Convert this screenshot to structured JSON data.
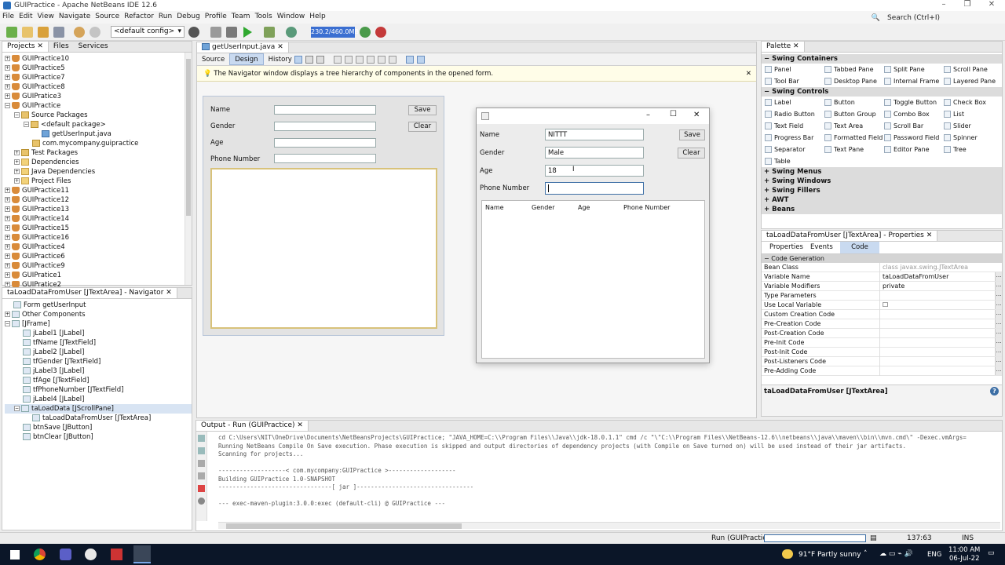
{
  "window": {
    "title": "GUIPractice - Apache NetBeans IDE 12.6"
  },
  "menu": [
    "File",
    "Edit",
    "View",
    "Navigate",
    "Source",
    "Refactor",
    "Run",
    "Debug",
    "Profile",
    "Team",
    "Tools",
    "Window",
    "Help"
  ],
  "search": {
    "placeholder": "Search (Ctrl+I)"
  },
  "toolbar": {
    "config": "<default config>",
    "memory": "230.2/460.0MB"
  },
  "projects": {
    "tabs": [
      "Projects",
      "Files",
      "Services"
    ],
    "items": [
      {
        "label": "GUIPractice10",
        "type": "cup",
        "indent": 0,
        "exp": "+"
      },
      {
        "label": "GUIPractice5",
        "type": "cup",
        "indent": 0,
        "exp": "+"
      },
      {
        "label": "GUIPractice7",
        "type": "cup",
        "indent": 0,
        "exp": "+"
      },
      {
        "label": "GUIPractice8",
        "type": "cup",
        "indent": 0,
        "exp": "+"
      },
      {
        "label": "GUIPratice3",
        "type": "cup",
        "indent": 0,
        "exp": "+"
      },
      {
        "label": "GUIPractice",
        "type": "cup",
        "indent": 0,
        "exp": "-"
      },
      {
        "label": "Source Packages",
        "type": "pkg",
        "indent": 1,
        "exp": "-"
      },
      {
        "label": "<default package>",
        "type": "pkg",
        "indent": 2,
        "exp": "-"
      },
      {
        "label": "getUserInput.java",
        "type": "jv",
        "indent": 3,
        "exp": ""
      },
      {
        "label": "com.mycompany.guipractice",
        "type": "pkg",
        "indent": 2,
        "exp": ""
      },
      {
        "label": "Test Packages",
        "type": "pkg",
        "indent": 1,
        "exp": "+"
      },
      {
        "label": "Dependencies",
        "type": "fld",
        "indent": 1,
        "exp": "+"
      },
      {
        "label": "Java Dependencies",
        "type": "fld",
        "indent": 1,
        "exp": "+"
      },
      {
        "label": "Project Files",
        "type": "fld",
        "indent": 1,
        "exp": "+"
      },
      {
        "label": "GUIPractice11",
        "type": "cup",
        "indent": 0,
        "exp": "+"
      },
      {
        "label": "GUIPractice12",
        "type": "cup",
        "indent": 0,
        "exp": "+"
      },
      {
        "label": "GUIPractice13",
        "type": "cup",
        "indent": 0,
        "exp": "+"
      },
      {
        "label": "GUIPractice14",
        "type": "cup",
        "indent": 0,
        "exp": "+"
      },
      {
        "label": "GUIPractice15",
        "type": "cup",
        "indent": 0,
        "exp": "+"
      },
      {
        "label": "GUIPractice16",
        "type": "cup",
        "indent": 0,
        "exp": "+"
      },
      {
        "label": "GUIPractice4",
        "type": "cup",
        "indent": 0,
        "exp": "+"
      },
      {
        "label": "GUIPractice6",
        "type": "cup",
        "indent": 0,
        "exp": "+"
      },
      {
        "label": "GUIPractice9",
        "type": "cup",
        "indent": 0,
        "exp": "+"
      },
      {
        "label": "GUIPratice1",
        "type": "cup",
        "indent": 0,
        "exp": "+"
      },
      {
        "label": "GUIPratice2",
        "type": "cup",
        "indent": 0,
        "exp": "+"
      }
    ]
  },
  "navigator": {
    "title": "taLoadDataFromUser [JTextArea] - Navigator",
    "items": [
      {
        "label": "Form getUserInput",
        "indent": 0,
        "exp": ""
      },
      {
        "label": "Other Components",
        "indent": 0,
        "exp": "+"
      },
      {
        "label": "[JFrame]",
        "indent": 0,
        "exp": "-"
      },
      {
        "label": "jLabel1 [JLabel]",
        "indent": 1,
        "exp": ""
      },
      {
        "label": "tfName [JTextField]",
        "indent": 1,
        "exp": ""
      },
      {
        "label": "jLabel2 [JLabel]",
        "indent": 1,
        "exp": ""
      },
      {
        "label": "tfGender [JTextField]",
        "indent": 1,
        "exp": ""
      },
      {
        "label": "jLabel3 [JLabel]",
        "indent": 1,
        "exp": ""
      },
      {
        "label": "tfAge [JTextField]",
        "indent": 1,
        "exp": ""
      },
      {
        "label": "tfPhoneNumber [JTextField]",
        "indent": 1,
        "exp": ""
      },
      {
        "label": "jLabel4 [JLabel]",
        "indent": 1,
        "exp": ""
      },
      {
        "label": "taLoadData [JScrollPane]",
        "indent": 1,
        "exp": "-"
      },
      {
        "label": "taLoadDataFromUser [JTextArea]",
        "indent": 2,
        "exp": ""
      },
      {
        "label": "btnSave [JButton]",
        "indent": 1,
        "exp": ""
      },
      {
        "label": "btnClear [JButton]",
        "indent": 1,
        "exp": ""
      }
    ]
  },
  "editor": {
    "tab": "getUserInput.java",
    "views": [
      "Source",
      "Design",
      "History"
    ],
    "info": "The Navigator window displays a tree hierarchy of components in the opened form."
  },
  "form": {
    "labels": [
      "Name",
      "Gender",
      "Age",
      "Phone Number"
    ],
    "save": "Save",
    "clear": "Clear"
  },
  "runwin": {
    "name": "NITTT",
    "gender": "Male",
    "age": "18",
    "phone": "",
    "save": "Save",
    "clear": "Clear",
    "columns": [
      "Name",
      "Gender",
      "Age",
      "Phone Number"
    ]
  },
  "palette": {
    "title": "Palette",
    "sections": [
      {
        "name": "Swing Containers",
        "open": true,
        "items": [
          "Panel",
          "Tabbed Pane",
          "Split Pane",
          "Scroll Pane",
          "Tool Bar",
          "Desktop Pane",
          "Internal Frame",
          "Layered Pane"
        ]
      },
      {
        "name": "Swing Controls",
        "open": true,
        "items": [
          "Label",
          "Button",
          "Toggle Button",
          "Check Box",
          "Radio Button",
          "Button Group",
          "Combo Box",
          "List",
          "Text Field",
          "Text Area",
          "Scroll Bar",
          "Slider",
          "Progress Bar",
          "Formatted Field",
          "Password Field",
          "Spinner",
          "Separator",
          "Text Pane",
          "Editor Pane",
          "Tree",
          "Table"
        ]
      },
      {
        "name": "Swing Menus",
        "open": false,
        "items": []
      },
      {
        "name": "Swing Windows",
        "open": false,
        "items": []
      },
      {
        "name": "Swing Fillers",
        "open": false,
        "items": []
      },
      {
        "name": "AWT",
        "open": false,
        "items": []
      },
      {
        "name": "Beans",
        "open": false,
        "items": []
      }
    ]
  },
  "properties": {
    "title": "taLoadDataFromUser [JTextArea] - Properties",
    "tabs": [
      "Properties",
      "Events",
      "Code"
    ],
    "group": "Code Generation",
    "rows": [
      {
        "k": "Bean Class",
        "v": "class javax.swing.JTextArea",
        "dots": false
      },
      {
        "k": "Variable Name",
        "v": "taLoadDataFromUser",
        "dots": true
      },
      {
        "k": "Variable Modifiers",
        "v": "private",
        "dots": true
      },
      {
        "k": "Type Parameters",
        "v": "",
        "dots": true
      },
      {
        "k": "Use Local Variable",
        "v": "☐",
        "dots": true
      },
      {
        "k": "Custom Creation Code",
        "v": "",
        "dots": true
      },
      {
        "k": "Pre-Creation Code",
        "v": "",
        "dots": true
      },
      {
        "k": "Post-Creation Code",
        "v": "",
        "dots": true
      },
      {
        "k": "Pre-Init Code",
        "v": "",
        "dots": true
      },
      {
        "k": "Post-Init Code",
        "v": "",
        "dots": true
      },
      {
        "k": "Post-Listeners Code",
        "v": "",
        "dots": true
      },
      {
        "k": "Pre-Adding Code",
        "v": "",
        "dots": true
      }
    ],
    "footer": "taLoadDataFromUser [JTextArea]"
  },
  "output": {
    "title": "Output - Run (GUIPractice)",
    "lines": [
      "cd C:\\Users\\NIT\\OneDrive\\Documents\\NetBeansProjects\\GUIPractice; \"JAVA_HOME=C:\\\\Program Files\\\\Java\\\\jdk-18.0.1.1\" cmd /c \"\\\"C:\\\\Program Files\\\\NetBeans-12.6\\\\netbeans\\\\java\\\\maven\\\\bin\\\\mvn.cmd\\\" -Dexec.vmArgs=",
      "Running NetBeans Compile On Save execution. Phase execution is skipped and output directories of dependency projects (with Compile on Save turned on) will be used instead of their jar artifacts.",
      "Scanning for projects...",
      "",
      "-------------------< com.mycompany:GUIPractice >-------------------",
      "Building GUIPractice 1.0-SNAPSHOT",
      "--------------------------------[ jar ]---------------------------------",
      "",
      "--- exec-maven-plugin:3.0.0:exec (default-cli) @ GUIPractice ---"
    ]
  },
  "status": {
    "run": "Run (GUIPractice)",
    "pos": "137:63",
    "ins": "INS"
  },
  "taskbar": {
    "weather": "91°F  Partly sunny",
    "lang": "ENG",
    "time": "11:00 AM",
    "date": "06-Jul-22"
  }
}
